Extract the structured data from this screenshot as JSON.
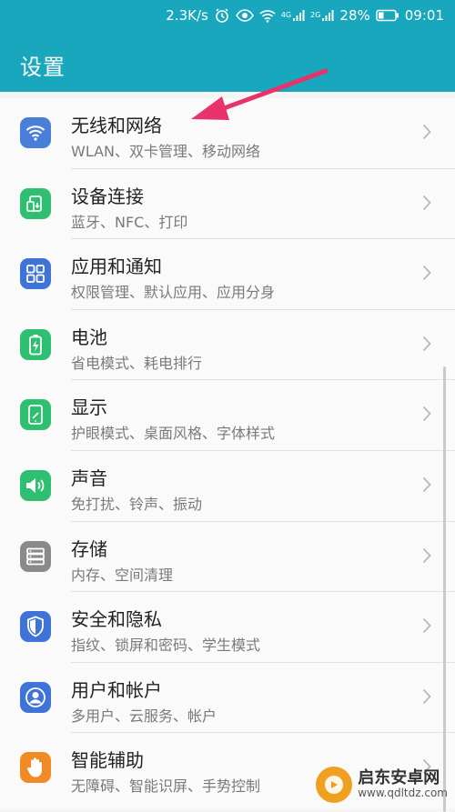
{
  "status": {
    "speed": "2.3K/s",
    "sim1": "4G",
    "sim2": "2G",
    "battery": "28%",
    "time": "09:01"
  },
  "header": {
    "title": "设置"
  },
  "rows": [
    {
      "title": "无线和网络",
      "subtitle": "WLAN、双卡管理、移动网络",
      "icon": "wifi-icon",
      "color": "#4a7fd9"
    },
    {
      "title": "设备连接",
      "subtitle": "蓝牙、NFC、打印",
      "icon": "device-connect-icon",
      "color": "#2fbf71"
    },
    {
      "title": "应用和通知",
      "subtitle": "权限管理、默认应用、应用分身",
      "icon": "apps-icon",
      "color": "#3f73d8"
    },
    {
      "title": "电池",
      "subtitle": "省电模式、耗电排行",
      "icon": "battery-icon",
      "color": "#2fbf71"
    },
    {
      "title": "显示",
      "subtitle": "护眼模式、桌面风格、字体样式",
      "icon": "display-icon",
      "color": "#2fbf71"
    },
    {
      "title": "声音",
      "subtitle": "免打扰、铃声、振动",
      "icon": "sound-icon",
      "color": "#2fbf71"
    },
    {
      "title": "存储",
      "subtitle": "内存、空间清理",
      "icon": "storage-icon",
      "color": "#8a8a8a"
    },
    {
      "title": "安全和隐私",
      "subtitle": "指纹、锁屏和密码、学生模式",
      "icon": "shield-icon",
      "color": "#3f73d8"
    },
    {
      "title": "用户和帐户",
      "subtitle": "多用户、云服务、帐户",
      "icon": "user-icon",
      "color": "#3f73d8"
    },
    {
      "title": "智能辅助",
      "subtitle": "无障碍、智能识屏、手势控制",
      "icon": "hand-icon",
      "color": "#f08a24"
    }
  ],
  "watermark": {
    "name": "启东安卓网",
    "url": "www.qdltdz.com"
  },
  "colors": {
    "header": "#18a7bd",
    "arrow": "#e8326a"
  }
}
